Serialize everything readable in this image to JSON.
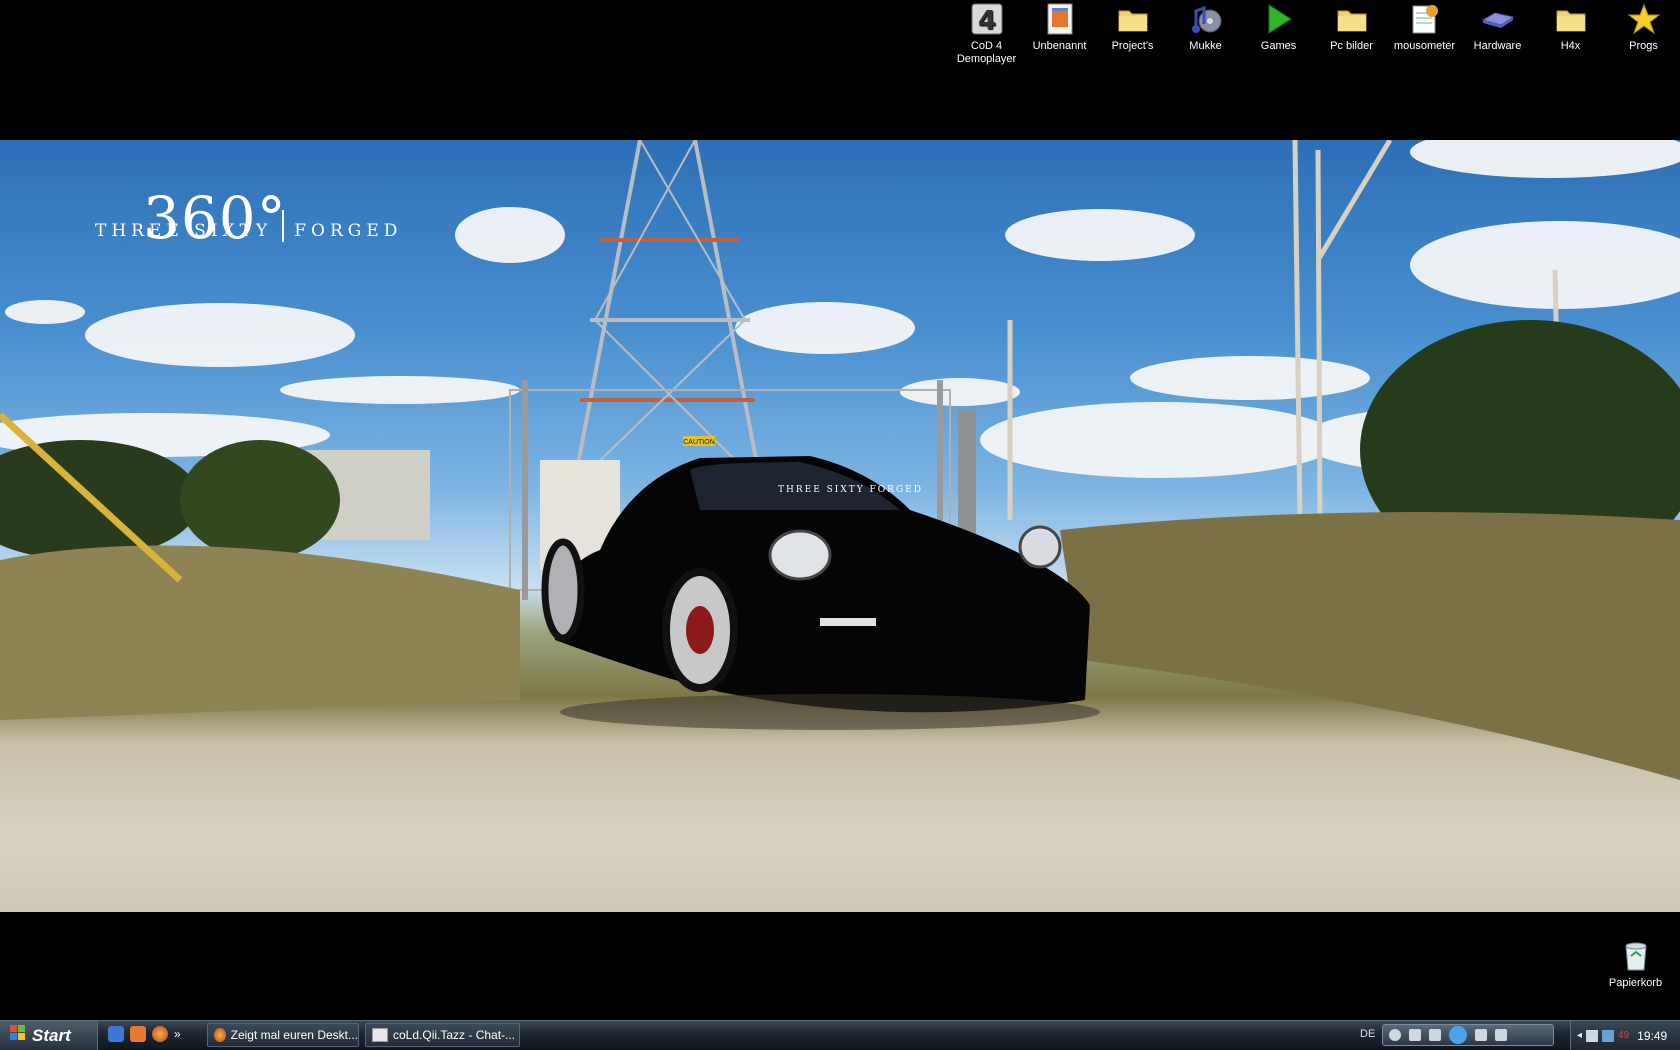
{
  "wallpaper": {
    "brand_number": "360°",
    "brand_left": "THREE SIXTY",
    "brand_right": "FORGED",
    "windshield_banner": "THREE SIXTY FORGED",
    "caution_sign": "CAUTION"
  },
  "desktop_icons": [
    {
      "label": "CoD 4 Demoplayer",
      "icon": "cod4-icon"
    },
    {
      "label": "Unbenannt",
      "icon": "document-icon"
    },
    {
      "label": "Project's",
      "icon": "folder-icon"
    },
    {
      "label": "Mukke",
      "icon": "music-icon"
    },
    {
      "label": "Games",
      "icon": "play-icon"
    },
    {
      "label": "Pc bilder",
      "icon": "folder-icon"
    },
    {
      "label": "mousometer",
      "icon": "notepad-icon"
    },
    {
      "label": "Hardware",
      "icon": "hardware-icon"
    },
    {
      "label": "H4x",
      "icon": "folder-icon"
    },
    {
      "label": "Progs",
      "icon": "star-icon"
    }
  ],
  "recycle_bin": {
    "label": "Papierkorb"
  },
  "taskbar": {
    "start_label": "Start",
    "quick_launch_overflow": "»",
    "tasks": [
      {
        "label": "Zeigt mal euren Deskt..."
      },
      {
        "label": "coLd.Qii.Tazz - Chat-..."
      }
    ],
    "language": "DE",
    "clock": "19:49",
    "tray_number": "49"
  }
}
